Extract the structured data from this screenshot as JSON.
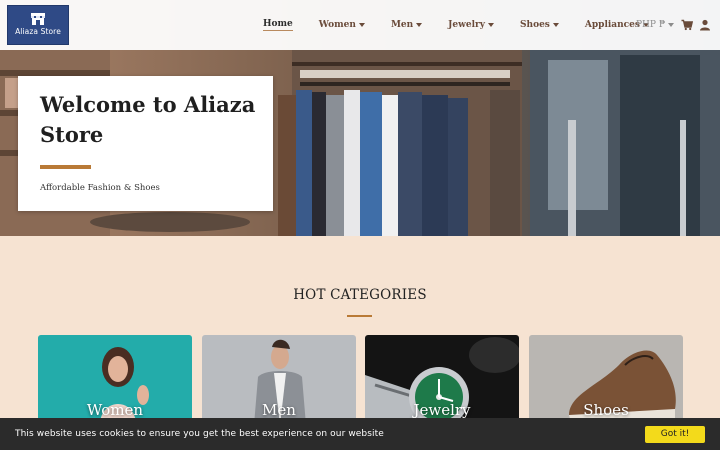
{
  "logo": {
    "text": "Aliaza Store"
  },
  "nav": {
    "items": [
      {
        "label": "Home",
        "active": true,
        "dropdown": false
      },
      {
        "label": "Women",
        "active": false,
        "dropdown": true
      },
      {
        "label": "Men",
        "active": false,
        "dropdown": true
      },
      {
        "label": "Jewelry",
        "active": false,
        "dropdown": true
      },
      {
        "label": "Shoes",
        "active": false,
        "dropdown": true
      },
      {
        "label": "Appliances",
        "active": false,
        "dropdown": true
      }
    ],
    "currency": "PHP ₱",
    "icons": [
      "cart-icon",
      "user-icon"
    ]
  },
  "hero": {
    "title": "Welcome to Aliaza Store",
    "subtitle": "Affordable Fashion & Shoes"
  },
  "categories": {
    "heading": "HOT CATEGORIES",
    "items": [
      {
        "label": "Women"
      },
      {
        "label": "Men"
      },
      {
        "label": "Jewelry"
      },
      {
        "label": "Shoes"
      }
    ]
  },
  "cookie": {
    "message": "This website uses cookies to ensure you get the best experience on our website",
    "button": "Got it!"
  },
  "colors": {
    "accent": "#b97a36",
    "page_bg": "#f6e3d2",
    "logo_bg": "#2f4a86",
    "cookie_bg": "#2b2b2b",
    "cookie_button": "#f3da1b"
  }
}
